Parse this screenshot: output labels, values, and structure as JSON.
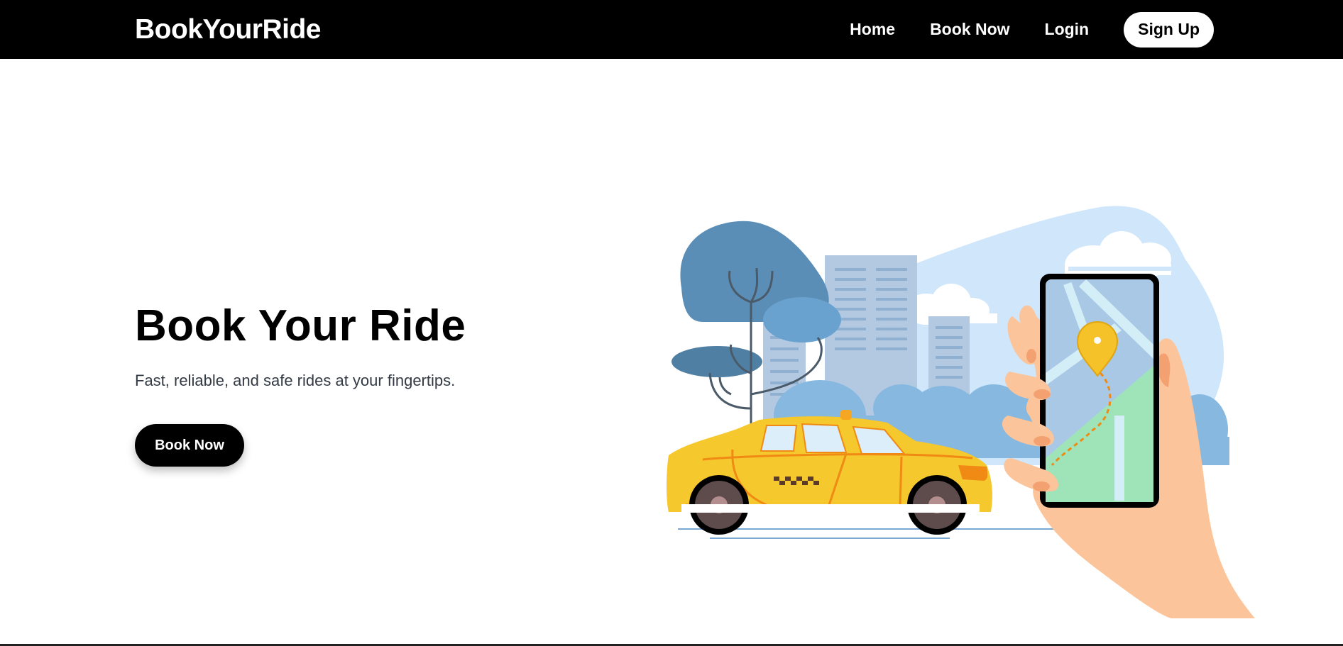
{
  "navbar": {
    "brand": "BookYourRide",
    "links": [
      {
        "label": "Home"
      },
      {
        "label": "Book Now"
      },
      {
        "label": "Login"
      }
    ],
    "signup_label": "Sign Up"
  },
  "hero": {
    "title": "Book Your Ride",
    "subtitle": "Fast, reliable, and safe rides at your fingertips.",
    "cta_label": "Book Now"
  },
  "colors": {
    "navbar_bg": "#000000",
    "taxi_yellow": "#f5c82e",
    "map_green": "#9fe3b8",
    "sky_blue": "#cfe6fb",
    "skin": "#fbc49a"
  },
  "icons": {
    "taxi": "taxi-car-illustration",
    "phone": "smartphone-map-illustration",
    "pin": "location-pin-icon"
  }
}
